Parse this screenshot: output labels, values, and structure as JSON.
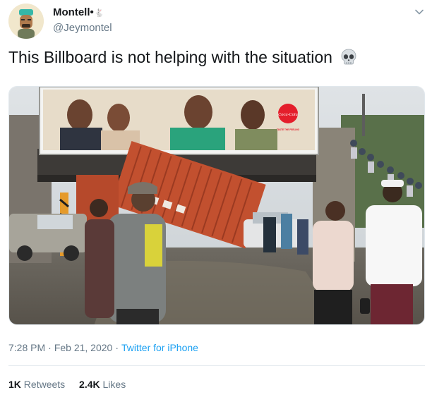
{
  "tweet": {
    "display_name": "Montell",
    "name_suffix": "•",
    "name_emoji": "🐇",
    "handle": "@Jeymontel",
    "text": "This Billboard is not helping with the situation",
    "text_emoji": "skull-icon",
    "media": {
      "billboard_logo": "Coca-Cola",
      "billboard_tagline": "TASTE THE FEELING"
    },
    "time": "7:28 PM",
    "separator": "·",
    "date": "Feb 21, 2020",
    "source": "Twitter for iPhone",
    "stats": {
      "retweets_count": "1K",
      "retweets_label": "Retweets",
      "likes_count": "2.4K",
      "likes_label": "Likes"
    }
  },
  "colors": {
    "link": "#1da1f2",
    "secondary_text": "#657786",
    "primary_text": "#14171a",
    "coca_cola_red": "#e41e2b",
    "container_rust": "#c2502f"
  }
}
